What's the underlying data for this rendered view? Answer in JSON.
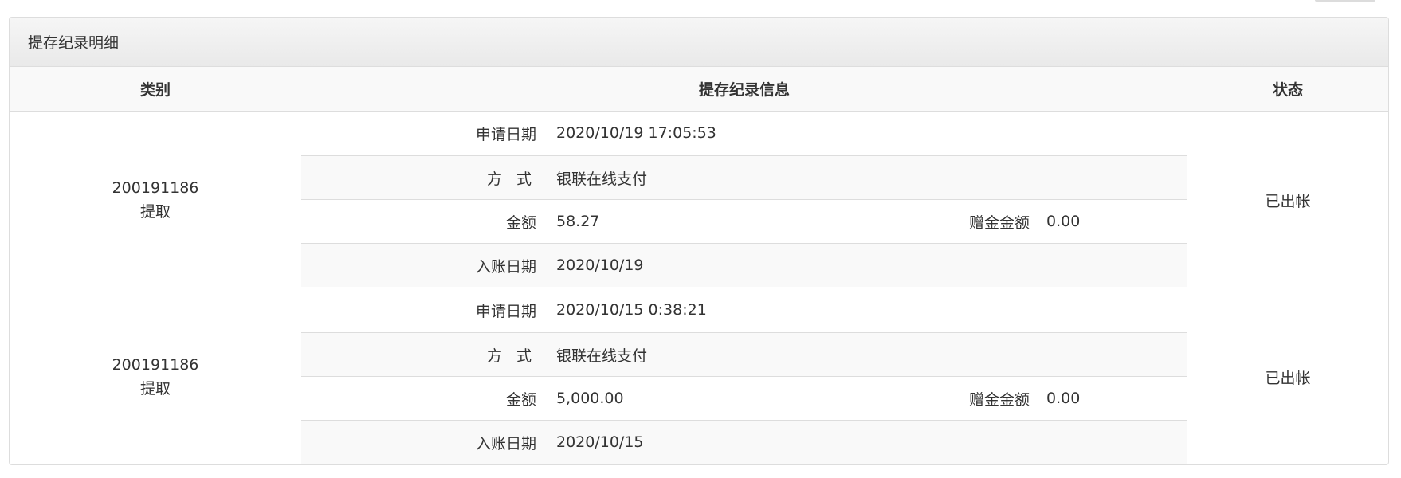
{
  "panel": {
    "title": "提存纪录明细"
  },
  "table": {
    "headers": {
      "category": "类别",
      "info": "提存纪录信息",
      "status": "状态"
    },
    "labels": {
      "apply_date": "申请日期",
      "method": "方 式",
      "amount": "金额",
      "bonus": "赠金金额",
      "posting_date": "入账日期"
    },
    "records": [
      {
        "id": "200191186",
        "type": "提取",
        "apply_date": "2020/10/19 17:05:53",
        "method": "银联在线支付",
        "amount": "58.27",
        "bonus": "0.00",
        "posting_date": "2020/10/19",
        "status": "已出帐"
      },
      {
        "id": "200191186",
        "type": "提取",
        "apply_date": "2020/10/15 0:38:21",
        "method": "银联在线支付",
        "amount": "5,000.00",
        "bonus": "0.00",
        "posting_date": "2020/10/15",
        "status": "已出帐"
      }
    ]
  }
}
